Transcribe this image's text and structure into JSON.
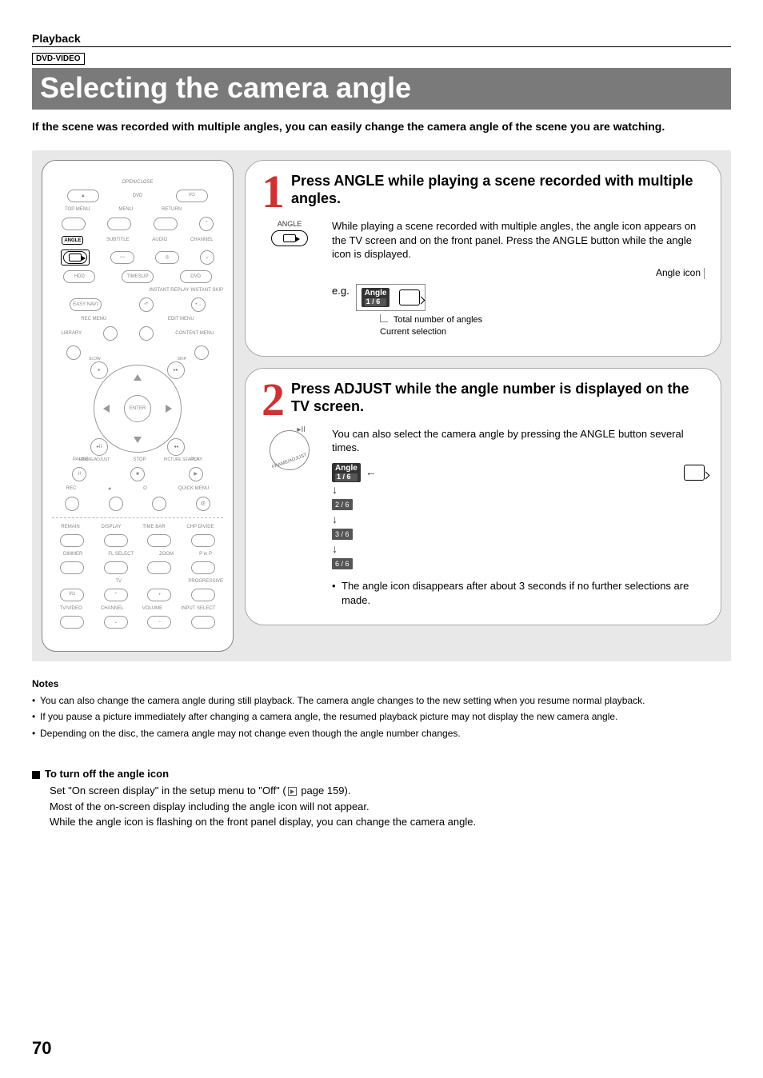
{
  "header": {
    "section": "Playback",
    "badge": "DVD-VIDEO"
  },
  "title": "Selecting the camera angle",
  "intro": "If the scene was recorded with multiple angles, you can easily change the camera angle of the scene you are watching.",
  "remote": {
    "top": {
      "open_close": "OPEN/CLOSE",
      "dvd": "DVD",
      "power": "I/⏻"
    },
    "menurow": {
      "top_menu": "TOP MENU",
      "menu": "MENU",
      "return": "RETURN",
      "up": "⌃"
    },
    "row4": {
      "angle_lbl": "ANGLE",
      "subtitle": "SUBTITLE",
      "audio": "AUDIO",
      "channel": "CHANNEL",
      "down": "⌄"
    },
    "row5": {
      "hdd": "HDD",
      "timeslip": "TIMESLIP",
      "dvd": "DVD"
    },
    "row6": {
      "easy": "EASY NAVI",
      "replay": "INSTANT REPLAY",
      "skip": "INSTANT SKIP"
    },
    "row7": {
      "rec_menu": "REC MENU",
      "edit_menu": "EDIT MENU"
    },
    "row8": {
      "library": "LIBRARY",
      "content": "CONTENT MENU"
    },
    "dpad": {
      "enter": "ENTER",
      "slow": "SLOW",
      "skip": "SKIP",
      "rev": "REV",
      "fwd": "FWD",
      "bl": "FRAME/ADJUST",
      "br": "PICTURE SEARCH"
    },
    "transport": {
      "pause": "PAUSE",
      "stop": "STOP",
      "play": "PLAY"
    },
    "misc": {
      "rec": "REC",
      "star": "★",
      "circle": "O",
      "quick": "QUICK MENU"
    },
    "lower1": {
      "remain": "REMAIN",
      "display": "DISPLAY",
      "timebar": "TIME BAR",
      "chp": "CHP DIVIDE"
    },
    "lower2": {
      "dimmer": "DIMMER",
      "flselect": "FL SELECT",
      "zoom": "ZOOM",
      "pinp": "P in P"
    },
    "tv": {
      "label": "TV",
      "prog": "PROGRESSIVE",
      "power": "I/⏻",
      "up": "⌃",
      "plus": "+",
      "tvvideo": "TV/VIDEO",
      "channel": "CHANNEL",
      "volume": "VOLUME",
      "input": "INPUT SELECT",
      "down": "⌄",
      "minus": "−"
    }
  },
  "steps": {
    "s1": {
      "num": "1",
      "title": "Press ANGLE while playing a scene recorded with multiple angles.",
      "btn_label": "ANGLE",
      "body": "While playing a scene recorded with multiple angles, the angle icon appears on the TV screen and on the front panel. Press the ANGLE button while the angle icon is displayed.",
      "angle_icon_label": "Angle icon",
      "eg": "e.g.",
      "chip_title": "Angle",
      "chip_val": "1 / 6",
      "legend_total": "Total number of angles",
      "legend_current": "Current selection"
    },
    "s2": {
      "num": "2",
      "title": "Press ADJUST while the angle number is displayed on the TV screen.",
      "adjust_lbl": "FRAME/ADJUST",
      "body": "You can also select the camera angle by pressing the ANGLE button several times.",
      "chip_title": "Angle",
      "chain": [
        "1 / 6",
        "2 / 6",
        "3 / 6",
        "6 / 6"
      ],
      "note": "The angle icon disappears after about 3 seconds if no further selections are made."
    }
  },
  "notes": {
    "heading": "Notes",
    "items": [
      "You can also change the camera angle during still playback. The camera angle changes to the new setting when you resume normal playback.",
      "If you pause a picture immediately after changing a camera angle, the resumed playback picture may not display the new camera angle.",
      "Depending on the disc, the camera angle may not change even though the angle number changes."
    ]
  },
  "turn_off": {
    "heading": "To turn off the angle icon",
    "line1a": "Set \"On screen display\" in the setup menu to \"Off\"  (",
    "line1b": " page 159).",
    "line2": "Most of the on-screen display including the angle icon will not appear.",
    "line3": "While the angle icon is flashing on the front panel display, you can change the camera angle."
  },
  "page_number": "70"
}
